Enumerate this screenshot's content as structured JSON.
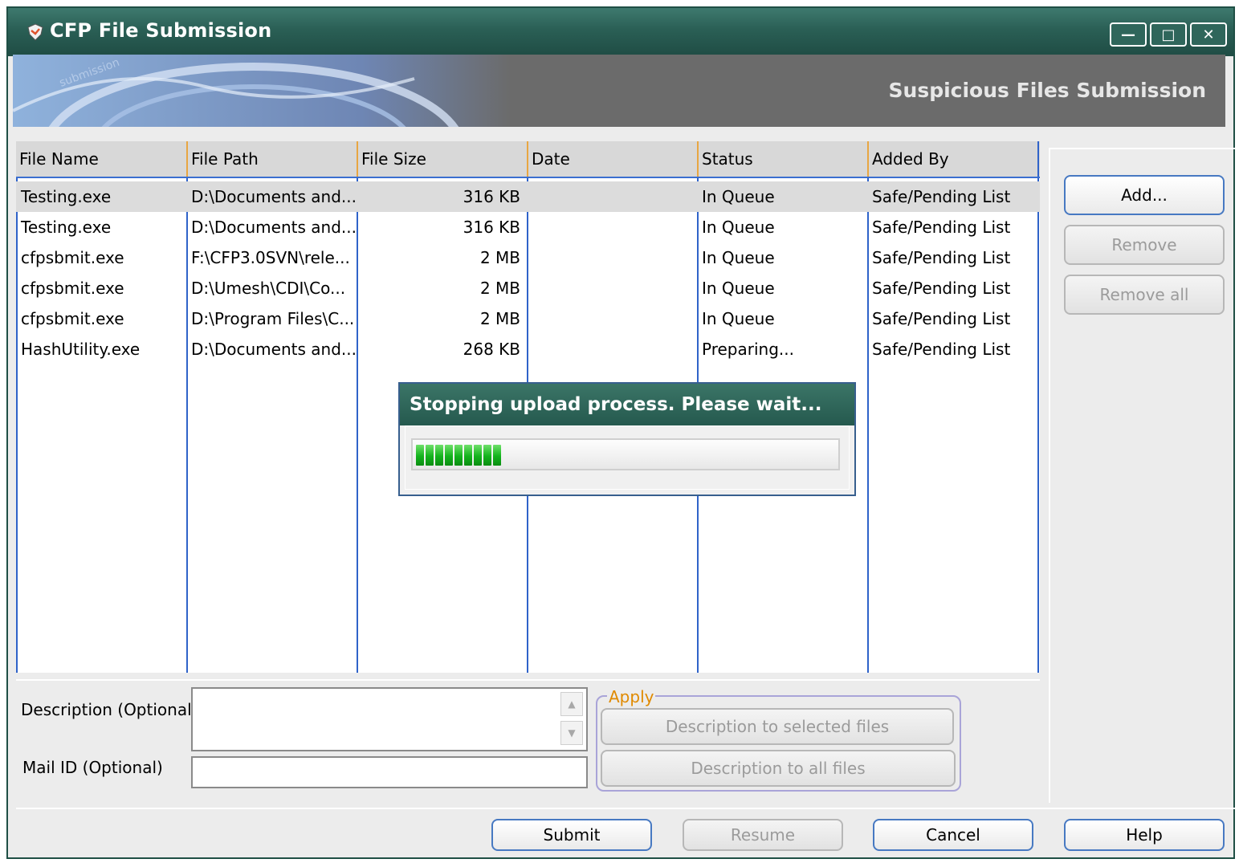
{
  "window": {
    "title": "CFP File Submission",
    "controls": [
      "minimize",
      "maximize",
      "close"
    ]
  },
  "banner": {
    "title": "Suspicious Files Submission"
  },
  "table": {
    "columns": [
      "File Name",
      "File Path",
      "File Size",
      "Date",
      "Status",
      "Added By"
    ],
    "rows": [
      {
        "name": "Testing.exe",
        "path": "D:\\Documents and...",
        "size": "316 KB",
        "date": "",
        "status": "In Queue",
        "added_by": "Safe/Pending List"
      },
      {
        "name": "Testing.exe",
        "path": "D:\\Documents and...",
        "size": "316 KB",
        "date": "",
        "status": "In Queue",
        "added_by": "Safe/Pending List"
      },
      {
        "name": "cfpsbmit.exe",
        "path": "F:\\CFP3.0SVN\\rele...",
        "size": "2 MB",
        "date": "",
        "status": "In Queue",
        "added_by": "Safe/Pending List"
      },
      {
        "name": "cfpsbmit.exe",
        "path": "D:\\Umesh\\CDI\\Co...",
        "size": "2 MB",
        "date": "",
        "status": "In Queue",
        "added_by": "Safe/Pending List"
      },
      {
        "name": "cfpsbmit.exe",
        "path": "D:\\Program Files\\C...",
        "size": "2 MB",
        "date": "",
        "status": "In Queue",
        "added_by": "Safe/Pending List"
      },
      {
        "name": "HashUtility.exe",
        "path": "D:\\Documents and...",
        "size": "268 KB",
        "date": "",
        "status": "Preparing...",
        "added_by": "Safe/Pending List"
      }
    ]
  },
  "side_buttons": {
    "add": "Add...",
    "remove": "Remove",
    "remove_all": "Remove all"
  },
  "form": {
    "description_label": "Description (Optional)",
    "description_value": "",
    "mail_label": "Mail ID (Optional)",
    "mail_value": ""
  },
  "apply": {
    "legend": "Apply",
    "to_selected": "Description to selected files",
    "to_all": "Description to all files"
  },
  "footer": {
    "submit": "Submit",
    "resume": "Resume",
    "cancel": "Cancel",
    "help": "Help"
  },
  "progress_dialog": {
    "title": "Stopping upload process. Please wait...",
    "progress": 0.2
  },
  "colors": {
    "titlebar": "#2a5f55",
    "accent": "#4779c2",
    "progress": "#13b31c",
    "apply_legend": "#e08a00"
  }
}
